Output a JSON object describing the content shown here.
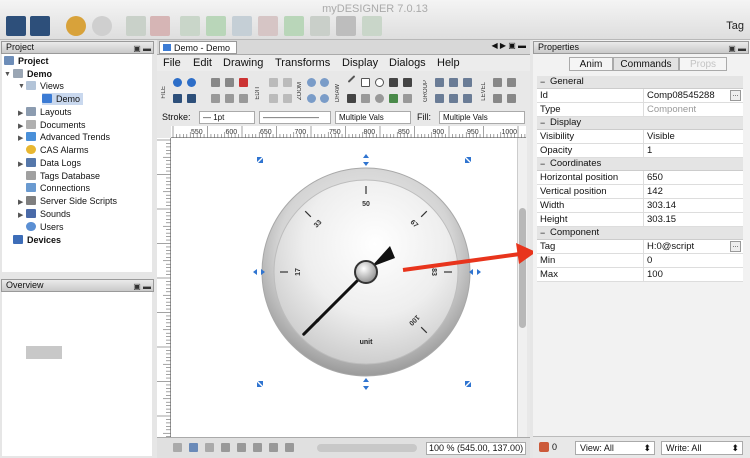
{
  "app": {
    "title": "myDESIGNER 7.0.13",
    "tag_button": "Tag"
  },
  "project_panel": {
    "title": "Project",
    "items": [
      {
        "label": "Project",
        "bold": true
      },
      {
        "label": "Demo",
        "bold": true
      },
      {
        "label": "Views"
      },
      {
        "label": "Demo"
      },
      {
        "label": "Layouts"
      },
      {
        "label": "Documents"
      },
      {
        "label": "Advanced Trends"
      },
      {
        "label": "CAS Alarms"
      },
      {
        "label": "Data Logs"
      },
      {
        "label": "Tags Database"
      },
      {
        "label": "Connections"
      },
      {
        "label": "Server Side Scripts"
      },
      {
        "label": "Sounds"
      },
      {
        "label": "Users"
      },
      {
        "label": "Devices",
        "bold": true
      }
    ]
  },
  "overview_panel": {
    "title": "Overview"
  },
  "editor": {
    "tab_label": "Demo - Demo",
    "menus": [
      "File",
      "Edit",
      "Drawing",
      "Transforms",
      "Display",
      "Dialogs",
      "Help"
    ],
    "group_labels": [
      "FILE",
      "EDIT",
      "ZOOM",
      "DRAW",
      "GROUP",
      "LEVEL"
    ],
    "stroke_label": "Stroke:",
    "stroke_width": "1pt",
    "line_style": "Multiple Vals",
    "fill_label": "Fill:",
    "fill_value": "Multiple Vals",
    "ruler_ticks": [
      "550",
      "600",
      "650",
      "700",
      "750",
      "800",
      "850",
      "900",
      "950",
      "1000"
    ],
    "zoom_status": "100 % (545.00, 137.00)"
  },
  "gauge": {
    "min": 0,
    "max": 100,
    "value": 0,
    "scale_labels": [
      "0",
      "17",
      "33",
      "50",
      "67",
      "83",
      "100"
    ],
    "unit": "unit"
  },
  "properties_panel": {
    "title": "Properties",
    "tabs": [
      "Anim",
      "Commands",
      "Props"
    ],
    "sections": [
      {
        "name": "General",
        "rows": [
          {
            "key": "Id",
            "value": "Comp08545288",
            "button": true
          },
          {
            "key": "Type",
            "value": "Component",
            "muted": true
          }
        ]
      },
      {
        "name": "Display",
        "rows": [
          {
            "key": "Visibility",
            "value": "Visible"
          },
          {
            "key": "Opacity",
            "value": "1"
          }
        ]
      },
      {
        "name": "Coordinates",
        "rows": [
          {
            "key": "Horizontal position",
            "value": "650"
          },
          {
            "key": "Vertical position",
            "value": "142"
          },
          {
            "key": "Width",
            "value": "303.14"
          },
          {
            "key": "Height",
            "value": "303.15"
          }
        ]
      },
      {
        "name": "Component",
        "rows": [
          {
            "key": "Tag",
            "value": "H:0@script",
            "button": true
          },
          {
            "key": "Min",
            "value": "0"
          },
          {
            "key": "Max",
            "value": "100"
          }
        ]
      }
    ],
    "bottom": {
      "count": "0",
      "view_filter": "View: All",
      "write_filter": "Write: All"
    }
  },
  "colors": {
    "accent_blue": "#1f6fd0",
    "annotation_red": "#e8341c"
  }
}
